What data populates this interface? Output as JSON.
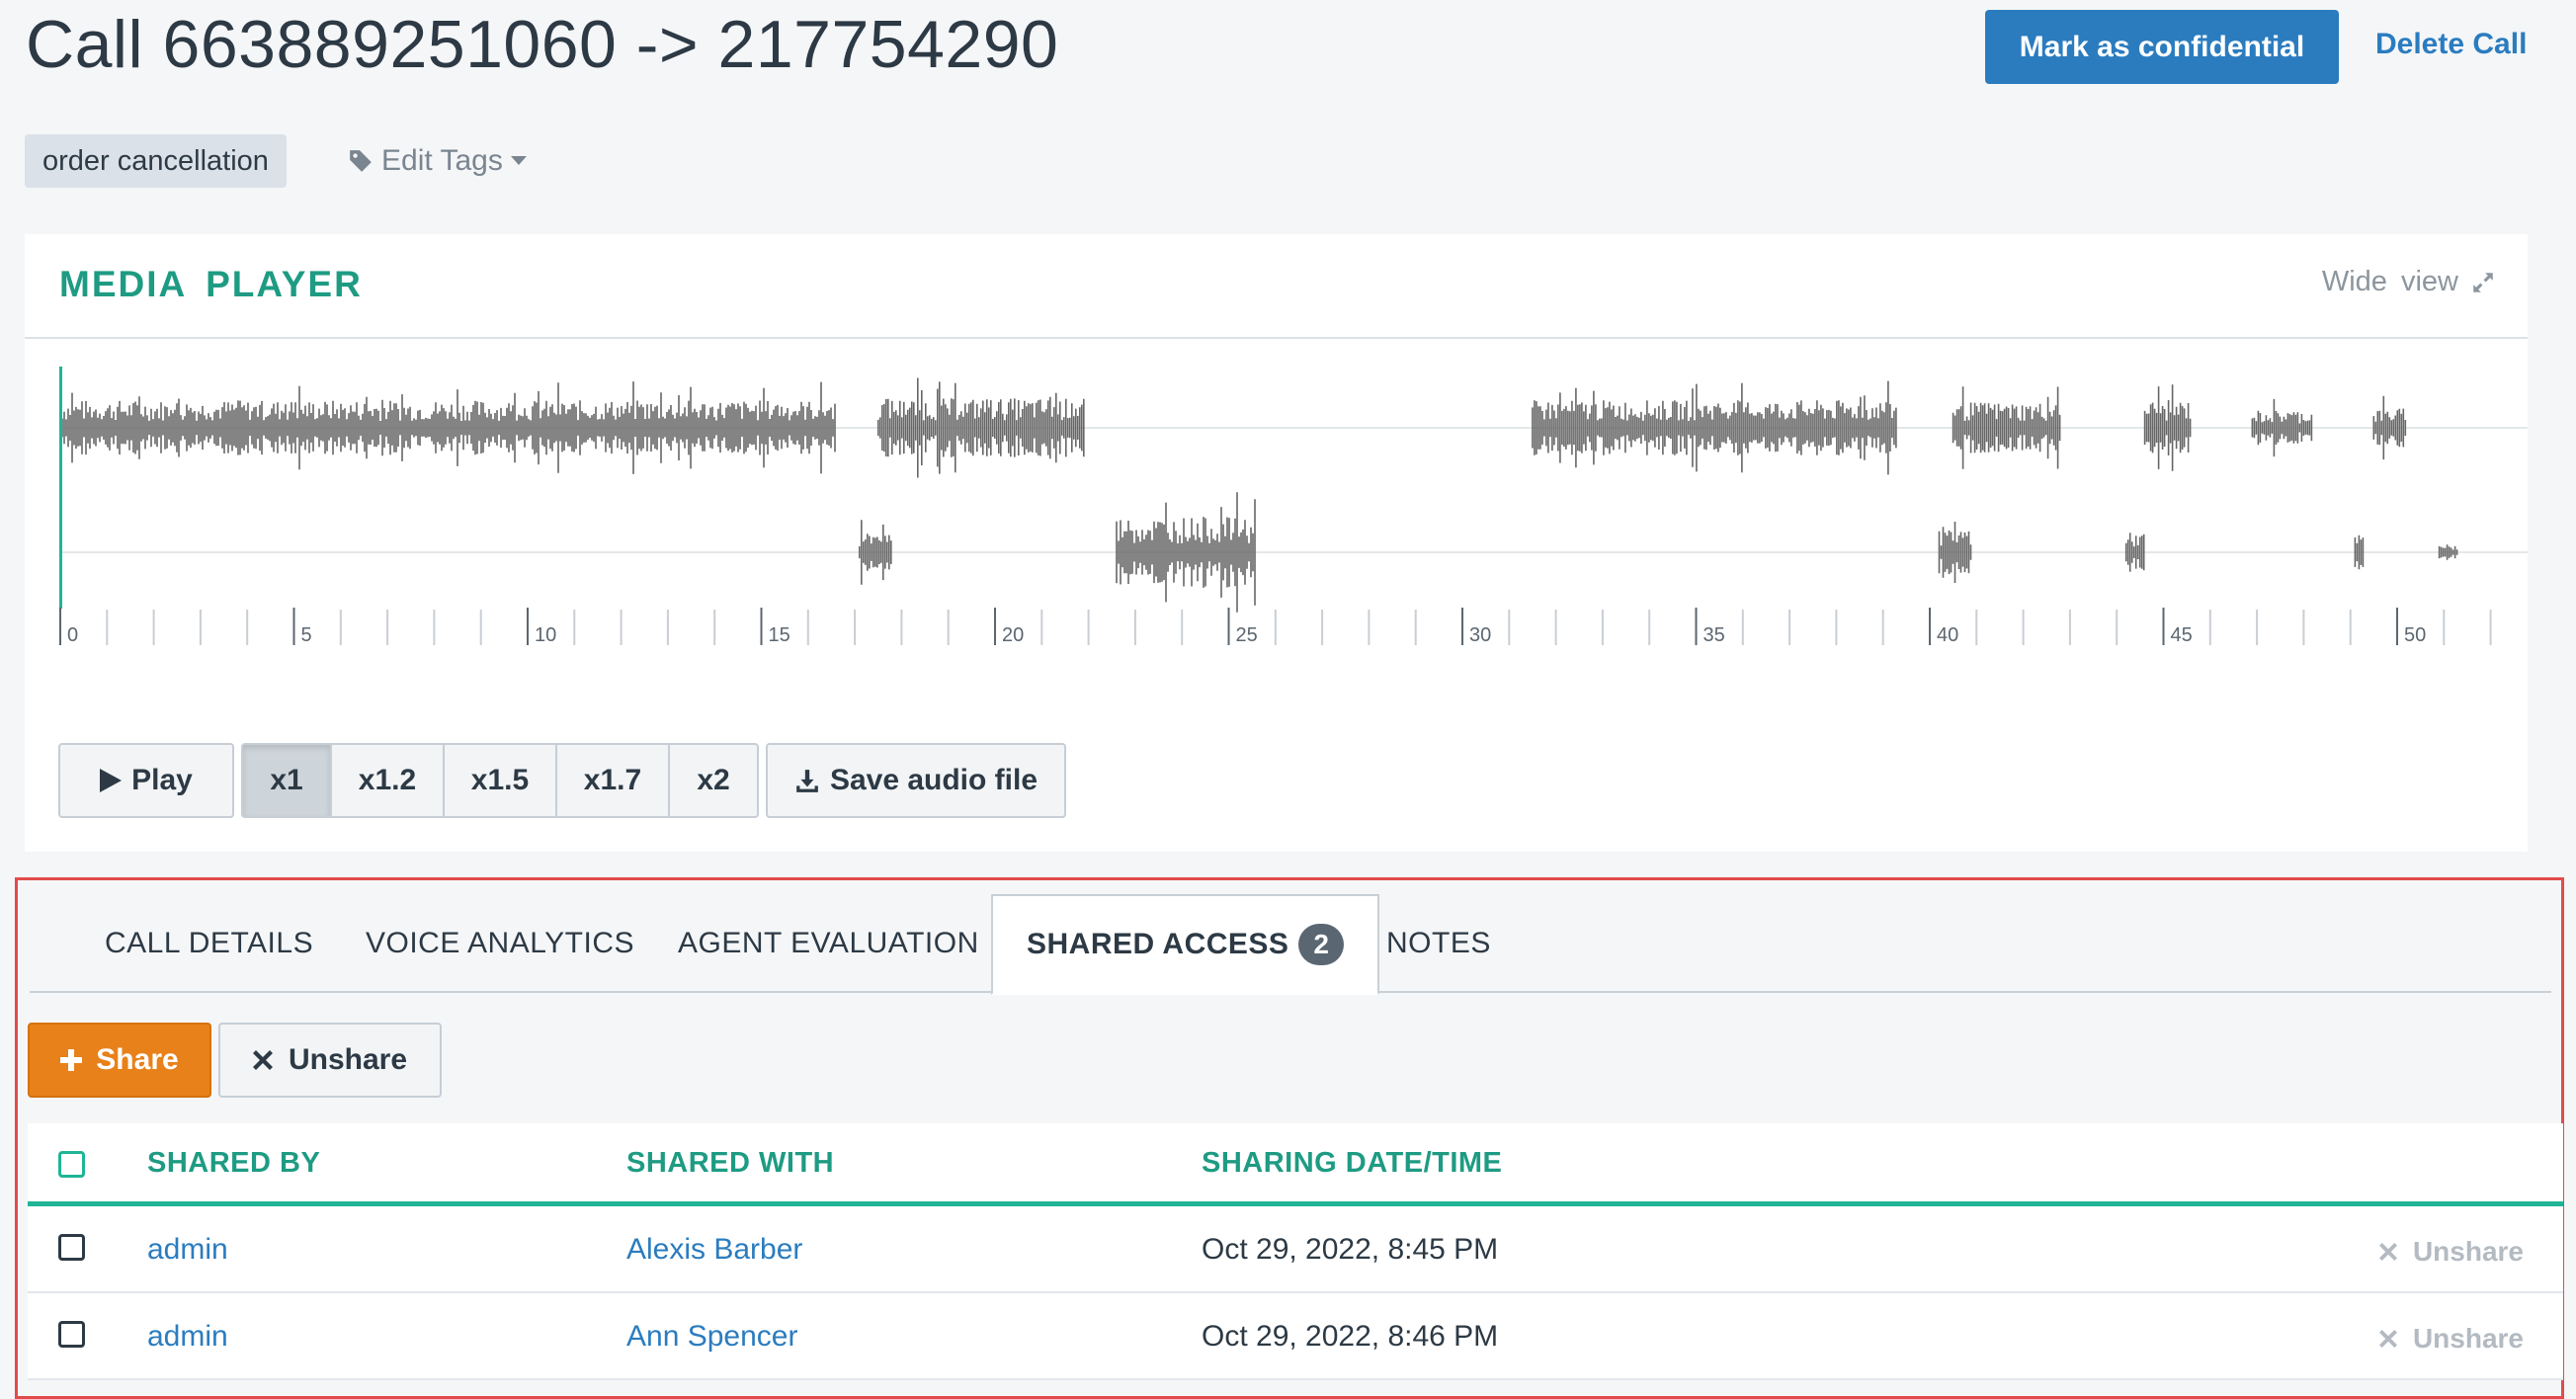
{
  "header": {
    "title": "Call 663889251060 -> 217754290",
    "confidential_label": "Mark as confidential",
    "delete_label": "Delete Call"
  },
  "tags": {
    "items": [
      "order cancellation"
    ],
    "edit_label": "Edit Tags"
  },
  "media_player": {
    "title": "MEDIA PLAYER",
    "wide_view_label": "Wide view",
    "timeline": {
      "labels": [
        "0",
        "5",
        "10",
        "15",
        "20",
        "25",
        "30",
        "35",
        "40",
        "45",
        "50"
      ]
    },
    "play_label": "Play",
    "speeds": [
      "x1",
      "x1.2",
      "x1.5",
      "x1.7",
      "x2"
    ],
    "active_speed": "x1",
    "save_label": "Save audio file"
  },
  "tabs": {
    "items": [
      {
        "label": "CALL DETAILS"
      },
      {
        "label": "VOICE ANALYTICS"
      },
      {
        "label": "AGENT EVALUATION"
      },
      {
        "label": "SHARED ACCESS",
        "badge": "2",
        "active": true
      },
      {
        "label": "NOTES"
      }
    ]
  },
  "shared_access": {
    "share_label": "Share",
    "unshare_label": "Unshare",
    "columns": [
      "SHARED BY",
      "SHARED WITH",
      "SHARING DATE/TIME"
    ],
    "rows": [
      {
        "shared_by": "admin",
        "shared_with": "Alexis Barber",
        "datetime": "Oct 29, 2022, 8:45 PM",
        "action": "Unshare"
      },
      {
        "shared_by": "admin",
        "shared_with": "Ann Spencer",
        "datetime": "Oct 29, 2022, 8:46 PM",
        "action": "Unshare"
      }
    ]
  },
  "colors": {
    "accent_green": "#1e9b83",
    "primary_blue": "#2b7cbf",
    "share_orange": "#e8811a",
    "highlight_red": "#e24b4b"
  }
}
